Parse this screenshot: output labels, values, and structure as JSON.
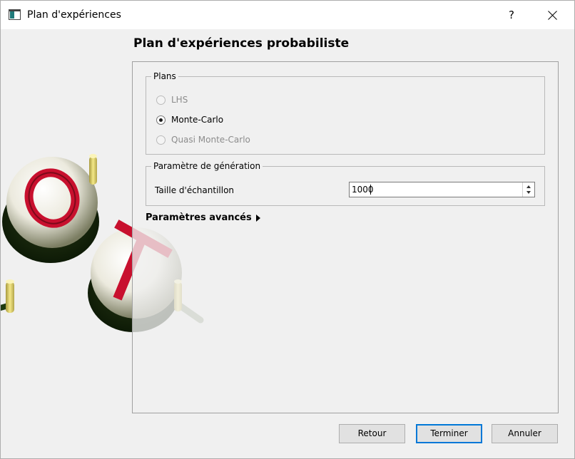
{
  "window": {
    "title": "Plan d'expériences",
    "help_label": "?"
  },
  "page": {
    "heading": "Plan d'expériences probabiliste"
  },
  "plans": {
    "group_title": "Plans",
    "options": [
      {
        "label": "LHS",
        "enabled": false,
        "selected": false
      },
      {
        "label": "Monte-Carlo",
        "enabled": true,
        "selected": true
      },
      {
        "label": "Quasi Monte-Carlo",
        "enabled": false,
        "selected": false
      }
    ]
  },
  "generation": {
    "group_title": "Paramètre de génération",
    "sample_size_label": "Taille d'échantillon",
    "sample_size_value": "1000"
  },
  "advanced": {
    "label": "Paramètres avancés"
  },
  "buttons": {
    "back": "Retour",
    "finish": "Terminer",
    "cancel": "Annuler"
  },
  "logo": {
    "letters": [
      "O",
      "T"
    ]
  },
  "colors": {
    "accent": "#0078d7",
    "logo_red": "#c8102e",
    "logo_yellow": "#e8d870"
  }
}
